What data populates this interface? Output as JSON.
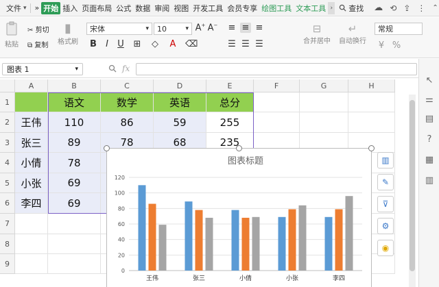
{
  "menubar": {
    "file": "文件",
    "expand": "»",
    "tabs": [
      "开始",
      "插入",
      "页面布局",
      "公式",
      "数据",
      "审阅",
      "视图",
      "开发工具",
      "会员专享",
      "绘图工具",
      "文本工具"
    ],
    "active_tab": "开始",
    "search": "查找"
  },
  "ribbon": {
    "paste": "粘贴",
    "cut": "剪切",
    "copy": "复制",
    "format_painter": "格式刷",
    "font_name": "宋体",
    "font_size": "10",
    "merge_center": "合并居中",
    "wrap_text": "自动换行",
    "number_format": "常规"
  },
  "formula_bar": {
    "name_box": "图表 1",
    "fx": "fx"
  },
  "sheet": {
    "columns": [
      "A",
      "B",
      "C",
      "D",
      "E",
      "F",
      "G",
      "H"
    ],
    "rows": [
      "1",
      "2",
      "3",
      "4",
      "5",
      "6",
      "7",
      "8",
      "9"
    ],
    "header_row": [
      "",
      "语文",
      "数学",
      "英语",
      "总分"
    ],
    "data": [
      [
        "王伟",
        "110",
        "86",
        "59",
        "255"
      ],
      [
        "张三",
        "89",
        "78",
        "68",
        "235"
      ],
      [
        "小倩",
        "78",
        "",
        "",
        ""
      ],
      [
        "小张",
        "69",
        "",
        "",
        ""
      ],
      [
        "李四",
        "69",
        "",
        "",
        ""
      ]
    ]
  },
  "chart_data": {
    "type": "bar",
    "title": "图表标题",
    "categories": [
      "王伟",
      "张三",
      "小倩",
      "小张",
      "李四"
    ],
    "series": [
      {
        "values": [
          110,
          89,
          78,
          69,
          69
        ],
        "color": "#5b9bd5"
      },
      {
        "values": [
          86,
          78,
          68,
          79,
          79
        ],
        "color": "#ed7d31"
      },
      {
        "values": [
          59,
          68,
          69,
          84,
          96
        ],
        "color": "#a5a5a5"
      }
    ],
    "ylim": [
      0,
      120
    ],
    "yticks": [
      0,
      20,
      40,
      60,
      80,
      100,
      120
    ],
    "grid": true
  },
  "colors": {
    "accent": "#2e9c57",
    "header_fill": "#92d050",
    "selection_fill": "#e9ecf8"
  }
}
